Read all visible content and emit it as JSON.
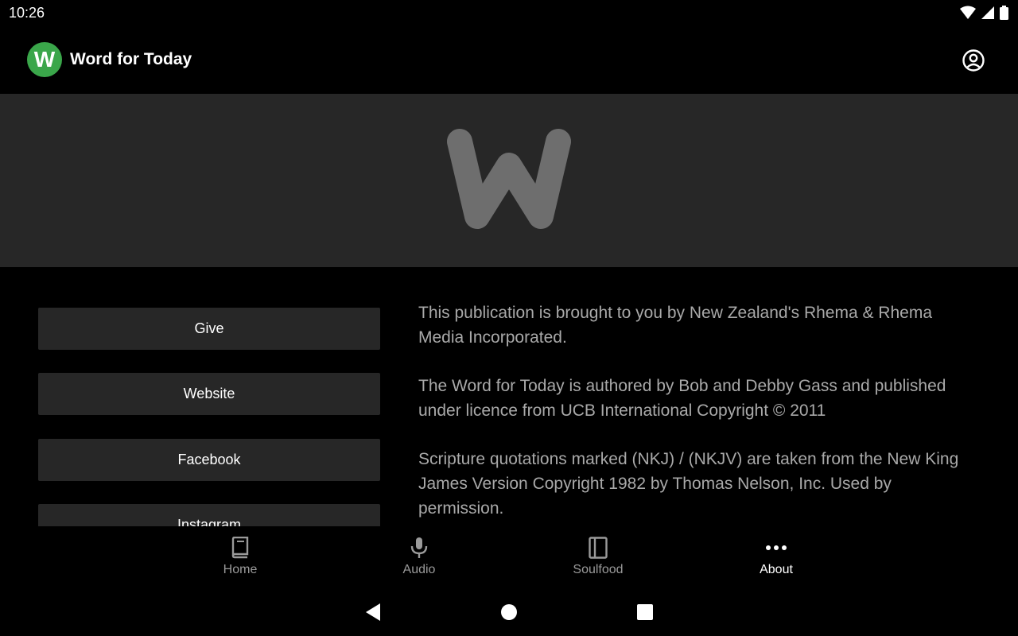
{
  "status": {
    "time": "10:26"
  },
  "app": {
    "logo_letter": "W",
    "title": "Word for Today"
  },
  "buttons": [
    {
      "label": "Give"
    },
    {
      "label": "Website"
    },
    {
      "label": "Facebook"
    },
    {
      "label": "Instagram"
    }
  ],
  "info": {
    "p1": "This publication is brought to you by New Zealand's Rhema & Rhema Media Incorporated.",
    "p2": "The Word for Today is authored by Bob and Debby Gass and published under licence from UCB International Copyright © 2011",
    "p3": "Scripture quotations marked (NKJ) / (NKJV) are taken from the New King James Version Copyright 1982 by Thomas Nelson, Inc. Used by permission."
  },
  "nav": [
    {
      "label": "Home",
      "icon": "book-icon"
    },
    {
      "label": "Audio",
      "icon": "microphone-icon"
    },
    {
      "label": "Soulfood",
      "icon": "notebook-icon"
    },
    {
      "label": "About",
      "icon": "more-horizontal-icon",
      "active": true
    }
  ],
  "colors": {
    "brand": "#3aa64a",
    "background": "#000000",
    "surface": "#272727",
    "text_muted": "#a9a9a9"
  }
}
